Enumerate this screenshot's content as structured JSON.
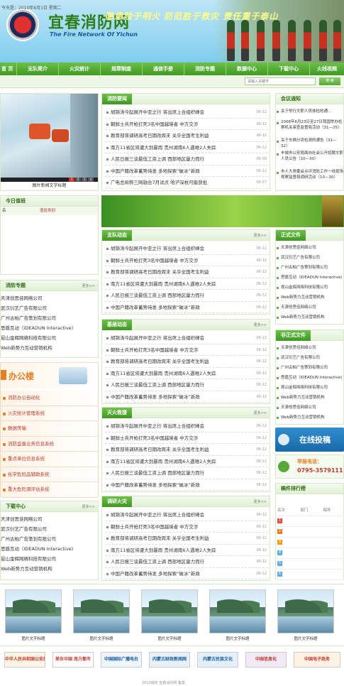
{
  "header": {
    "title": "宜春消防网",
    "subtitle": "The Fire Network Of Yichun"
  },
  "nav": [
    "首 页",
    "支队简介",
    "火灾统计",
    "规章制度",
    "通信手册",
    "消防专题",
    "数据中心",
    "下载中心",
    "火线视频"
  ],
  "datebar": {
    "date": "今天是：2010年6月1日 星期二",
    "search_placeholder": "请输入关键字",
    "search_button": "搜 索"
  },
  "slideshow": {
    "caption": "图片新闻文字标题",
    "pages": [
      "1",
      "2",
      "3",
      "4"
    ]
  },
  "duty": {
    "title": "今日值班",
    "col1": "名",
    "col2": "值班类别"
  },
  "topics": {
    "title": "消防专题",
    "more": "更多>>",
    "items": [
      "天津创思佳网络公司",
      "武汉衍艺广告有限公司",
      "广州古柏广告策划有限公司",
      "思盾互动（IDEADUN Interactive)",
      "昆山金辉网络科技有限公司",
      "Web新势力互动营销机构"
    ]
  },
  "office": {
    "title": "办公楼",
    "items": [
      "消防办公自动化",
      "火灾统计管理系统",
      "数据传输",
      "消防监督业务信息系统",
      "重点单位信息系统",
      "化学危险品辅助系统",
      "重大危险源评估系统"
    ]
  },
  "download": {
    "title": "下载中心",
    "more": "更多>>",
    "items": [
      "天津创思佳网络公司",
      "武汉衍艺广告有限公司",
      "广州古柏广告策划有限公司",
      "思盾互动（IDEADUN Interactive)",
      "昆山金辉网络科技有限公司",
      "Web新势力互动营销机构"
    ]
  },
  "news_sections": [
    {
      "title": "消防要闻",
      "more": "",
      "items": [
        {
          "t": "胡锦涛今起展开中亚之行 将出席上合组织峰会",
          "d": "06-12"
        },
        {
          "t": "朝鲜士兵开枪打死3名中国越境者 中方交涉",
          "d": "06-12"
        },
        {
          "t": "教育部将调研高考日期改周末 关乎全国考生利益",
          "d": "06-12"
        },
        {
          "t": "南方11省区将遭大到暴雨 贵州湖南6人遇难2人失踪",
          "d": "06-12"
        },
        {
          "t": "人民日报三谈最低工资上调 西部地区量力而行",
          "d": "06-09"
        },
        {
          "t": "中国户籍改革蓄势待发 多地探索“破冰”新政",
          "d": "06-12"
        },
        {
          "t": "广电总局称三网融合7月试点 哈沪深杭可能获批",
          "d": "06-07"
        }
      ]
    },
    {
      "title": "支队动态",
      "more": "更多>>",
      "items": [
        {
          "t": "胡锦涛今起展开中亚之行 将出席上合组织峰会",
          "d": "06-12"
        },
        {
          "t": "朝鲜士兵开枪打死3名中国越境者 中方交涉",
          "d": "06-12"
        },
        {
          "t": "教育部将调研高考日期改周末 关乎全国考生利益",
          "d": "06-12"
        },
        {
          "t": "南方11省区将遭大到暴雨 贵州湖南6人遇难2人失踪",
          "d": "06-12"
        },
        {
          "t": "人民日报三谈最低工资上调 西部地区量力而行",
          "d": "06-12"
        },
        {
          "t": "中国户籍改革蓄势待发 多地探索“破冰”新政",
          "d": "06-12"
        }
      ]
    },
    {
      "title": "基层动态",
      "more": "更多>>",
      "items": [
        {
          "t": "胡锦涛今起展开中亚之行 将出席上合组织峰会",
          "d": "06-12"
        },
        {
          "t": "朝鲜士兵开枪打死3名中国越境者 中方交涉",
          "d": "06-12"
        },
        {
          "t": "教育部将调研高考日期改周末 关乎全国考生利益",
          "d": "06-12"
        },
        {
          "t": "南方11省区将遭大到暴雨 贵州湖南6人遇难2人失踪",
          "d": "06-12"
        },
        {
          "t": "人民日报三谈最低工资上调 西部地区量力而行",
          "d": "06-12"
        },
        {
          "t": "中国户籍改革蓄势待发 多地探索“破冰”新政",
          "d": "06-12"
        }
      ]
    },
    {
      "title": "灭火救援",
      "more": "更多>>",
      "items": [
        {
          "t": "胡锦涛今起展开中亚之行 将出席上合组织峰会",
          "d": "06-12"
        },
        {
          "t": "朝鲜士兵开枪打死3名中国越境者 中方交涉",
          "d": "06-12"
        },
        {
          "t": "教育部将调研高考日期改周末 关乎全国考生利益",
          "d": "06-12"
        },
        {
          "t": "南方11省区将遭大到暴雨 贵州湖南6人遇难2人失踪",
          "d": "06-12"
        },
        {
          "t": "人民日报三谈最低工资上调 西部地区量力而行",
          "d": "06-12"
        },
        {
          "t": "中国户籍改革蓄势待发 多地探索“破冰”新政",
          "d": "06-12"
        }
      ]
    },
    {
      "title": "调研火灾",
      "more": "更多>>",
      "items": [
        {
          "t": "胡锦涛今起展开中亚之行 将出席上合组织峰会",
          "d": "06-12"
        },
        {
          "t": "朝鲜士兵开枪打死3名中国越境者 中方交涉",
          "d": "06-12"
        },
        {
          "t": "教育部将调研高考日期改周末 关乎全国考生利益",
          "d": "06-12"
        },
        {
          "t": "南方11省区将遭大到暴雨 贵州湖南6人遇难2人失踪",
          "d": "06-12"
        },
        {
          "t": "人民日报三谈最低工资上调 西部地区量力而行",
          "d": "06-12"
        },
        {
          "t": "中国户籍改革蓄势待发 多地探索“破冰”新政",
          "d": "06-12"
        }
      ]
    }
  ],
  "banner": {
    "text": "隐患险于明火 防范胜于救灾 责任重于泰山"
  },
  "meetings": {
    "title": "会议通知",
    "items": [
      "关于举行文职人员体检的通…",
      "2008年6月23日至27日我国举办检察机关审查监督局活动（31—25）",
      "关于车辆分流检测的通告（31—32）",
      "丰城市公安局面向社会公开招聘文职人员公告（10—30）",
      "市人大常委会点评消防工作一线现场视察监督局调研活动（10—30）"
    ]
  },
  "official_docs": {
    "title": "正式文件",
    "items": [
      "天津创思佳网络公司",
      "武汉衍艺广告有限公司",
      "广州古柏广告策划有限公司",
      "思盾互动（IDEADUN Interactive)",
      "昆山金辉网络科技有限公司",
      "Web新势力互动营销机构",
      "天津创思佳网络公司",
      "Web新势力互动营销机构"
    ]
  },
  "unofficial_docs": {
    "title": "非正式文件",
    "items": [
      "天津创思佳网络公司",
      "武汉衍艺广告有限公司",
      "广州古柏广告策划有限公司",
      "思盾互动（IDEADUN Interactive)",
      "昆山金辉网络科技有限公司",
      "Web新势力互动营销机构",
      "天津创思佳网络公司",
      "Web新势力互动营销机构"
    ]
  },
  "online_submit": "在线投稿",
  "report_line": {
    "label": "举报电话：",
    "number": "0795-3579111"
  },
  "ranking": {
    "title": "稿件排行榜",
    "headers": [
      "名次",
      "部门",
      "稿件"
    ],
    "ranks": [
      "1",
      "2",
      "3",
      "4",
      "5",
      "6"
    ]
  },
  "gallery": [
    "图片文字标题",
    "图片文字标题",
    "图片文字标题",
    "图片文字标题",
    "图片文字标题"
  ],
  "links": [
    "中华人民共和国公安部消防局",
    "美东中国 南方都市",
    "中国国际广播电台",
    "内蒙古财政新闻网",
    "内蒙古民族文化",
    "中国信息化",
    "中国电子政务"
  ],
  "footer": "2010版权 宜春消防网 备案"
}
